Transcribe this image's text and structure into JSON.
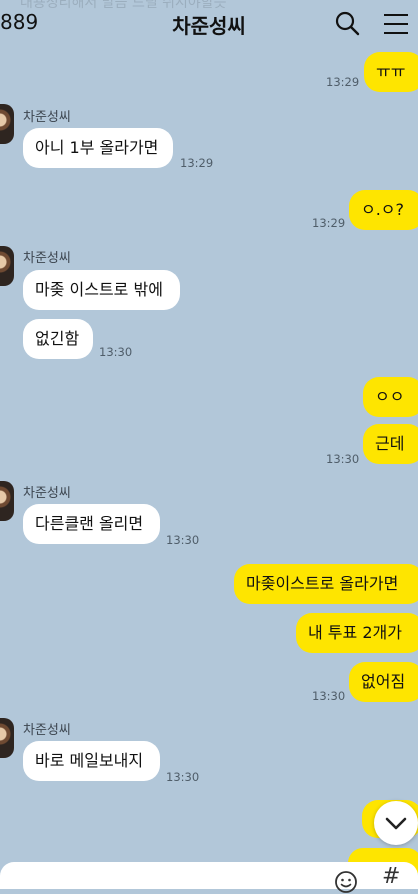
{
  "header": {
    "unread_count": "889",
    "title": "차준성씨",
    "faded_notice": "대용정리해서 말씀 드릴 쉬시야할듯"
  },
  "messages": [
    {
      "side": "me",
      "text": "ㅠㅠ",
      "time": "13:29"
    },
    {
      "side": "other",
      "sender": "차준성씨",
      "text": "아니 1부 올라가면",
      "time": "13:29"
    },
    {
      "side": "me",
      "text": "ㅇ.ㅇ?",
      "time": "13:29"
    },
    {
      "side": "other",
      "sender": "차준성씨",
      "text": "마좆 이스트로 밖에"
    },
    {
      "side": "other",
      "text": "없긴함",
      "time": "13:30"
    },
    {
      "side": "me",
      "text": "ㅇㅇ"
    },
    {
      "side": "me",
      "text": "근데",
      "time": "13:30"
    },
    {
      "side": "other",
      "sender": "차준성씨",
      "text": "다른클랜 올리면",
      "time": "13:30"
    },
    {
      "side": "me",
      "text": "마좆이스트로 올라가면"
    },
    {
      "side": "me",
      "text": "내 투표 2개가"
    },
    {
      "side": "me",
      "text": "없어짐",
      "time": "13:30"
    },
    {
      "side": "other",
      "sender": "차준성씨",
      "text": "바로 메일보내지",
      "time": "13:30"
    }
  ],
  "icons": {
    "search": "search-icon",
    "menu": "menu-icon",
    "scroll_down": "chevron-down-icon",
    "emoji": "emoji-icon",
    "hash": "hash-icon"
  },
  "input": {
    "hash_label": "#"
  },
  "colors": {
    "background": "#b2c7d9",
    "my_bubble": "#fee500",
    "other_bubble": "#ffffff"
  }
}
